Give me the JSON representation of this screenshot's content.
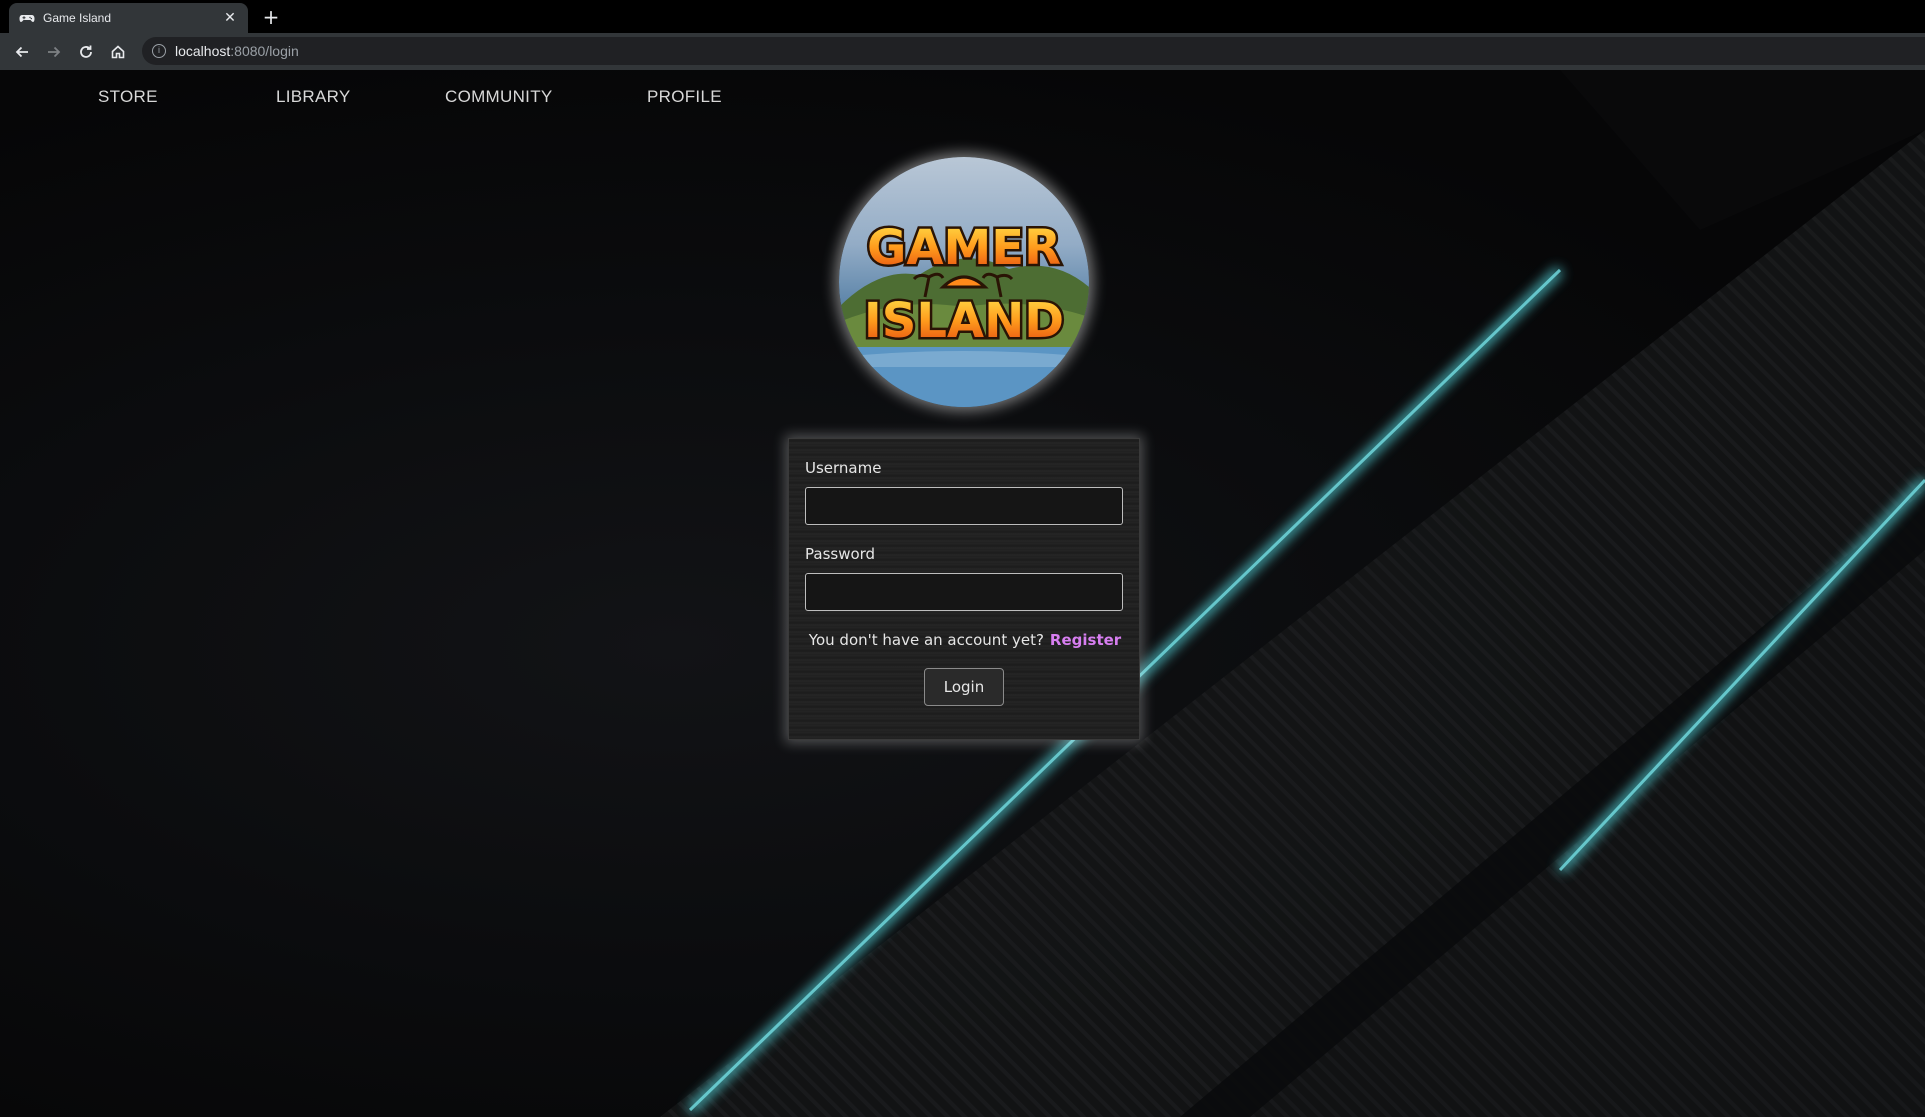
{
  "browser": {
    "tab_title": "Game Island",
    "tab_icon": "gamepad-icon",
    "url_host": "localhost",
    "url_path": ":8080/login"
  },
  "nav": {
    "items": [
      "STORE",
      "LIBRARY",
      "COMMUNITY",
      "PROFILE"
    ]
  },
  "logo": {
    "line1": "GAMER",
    "line2": "ISLAND"
  },
  "login": {
    "username_label": "Username",
    "username_value": "",
    "password_label": "Password",
    "password_value": "",
    "register_prompt": "You don't have an account yet?",
    "register_link": "Register",
    "submit_label": "Login"
  },
  "colors": {
    "accent_cyan": "#4fc3c9",
    "register_link": "#d77ef0",
    "background": "#0b0c0e"
  }
}
